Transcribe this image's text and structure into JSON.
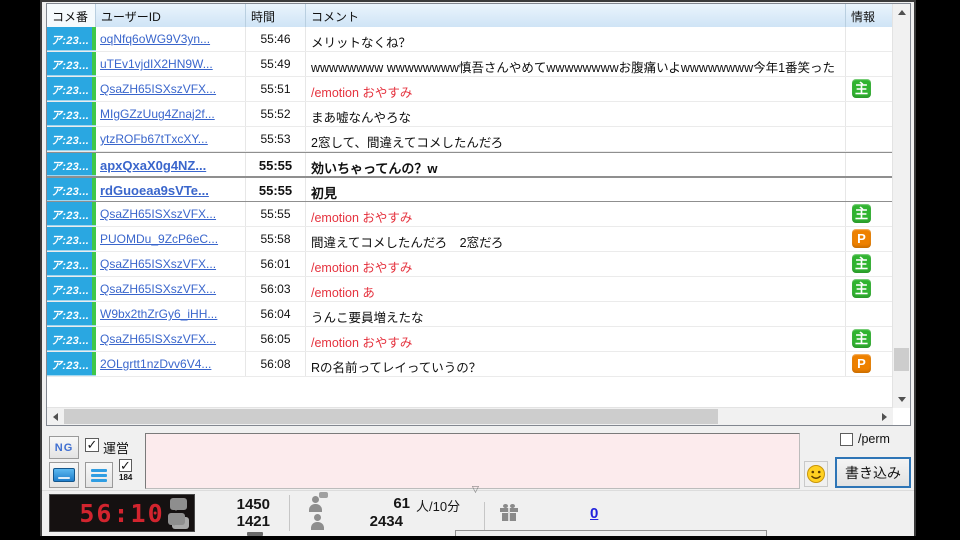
{
  "table": {
    "headers": {
      "num": "コメ番",
      "user": "ユーザーID",
      "time": "時間",
      "comment": "コメント",
      "info": "情報"
    },
    "rows": [
      {
        "seat": "ア:23...",
        "user": "oqNfq6oWG9V3yn...",
        "time": "55:46",
        "comment": "メリットなくね？",
        "red": false,
        "bold": false,
        "badge": ""
      },
      {
        "seat": "ア:23...",
        "user": "uTEv1vjdIX2HN9W...",
        "time": "55:49",
        "comment": "wwwwwwww wwwwwwww慎吾さんやめてwwwwwwwwお腹痛いよwwwwwwww今年1番笑った",
        "red": false,
        "bold": false,
        "badge": ""
      },
      {
        "seat": "ア:23...",
        "user": "QsaZH65ISXszVFX...",
        "time": "55:51",
        "comment": "/emotion おやすみ",
        "red": true,
        "bold": false,
        "badge": "主"
      },
      {
        "seat": "ア:23...",
        "user": "MIgGZzUug4Znaj2f...",
        "time": "55:52",
        "comment": "まあ嘘なんやろな",
        "red": false,
        "bold": false,
        "badge": ""
      },
      {
        "seat": "ア:23...",
        "user": "ytzROFb67tTxcXY...",
        "time": "55:53",
        "comment": "2窓して、間違えてコメしたんだろ",
        "red": false,
        "bold": false,
        "badge": ""
      },
      {
        "seat": "ア:23...",
        "user": "apxQxaX0g4NZ...",
        "time": "55:55",
        "comment": "効いちゃってんの？w",
        "red": false,
        "bold": true,
        "badge": ""
      },
      {
        "seat": "ア:23...",
        "user": "rdGuoeaa9sVTe...",
        "time": "55:55",
        "comment": "初見",
        "red": false,
        "bold": true,
        "badge": ""
      },
      {
        "seat": "ア:23...",
        "user": "QsaZH65ISXszVFX...",
        "time": "55:55",
        "comment": "/emotion おやすみ",
        "red": true,
        "bold": false,
        "badge": "主"
      },
      {
        "seat": "ア:23...",
        "user": "PUOMDu_9ZcP6eC...",
        "time": "55:58",
        "comment": "間違えてコメしたんだろ　2窓だろ",
        "red": false,
        "bold": false,
        "badge": "P"
      },
      {
        "seat": "ア:23...",
        "user": "QsaZH65ISXszVFX...",
        "time": "56:01",
        "comment": "/emotion おやすみ",
        "red": true,
        "bold": false,
        "badge": "主"
      },
      {
        "seat": "ア:23...",
        "user": "QsaZH65ISXszVFX...",
        "time": "56:03",
        "comment": "/emotion あ",
        "red": true,
        "bold": false,
        "badge": "主"
      },
      {
        "seat": "ア:23...",
        "user": "W9bx2thZrGy6_iHH...",
        "time": "56:04",
        "comment": "うんこ要員増えたな",
        "red": false,
        "bold": false,
        "badge": ""
      },
      {
        "seat": "ア:23...",
        "user": "QsaZH65ISXszVFX...",
        "time": "56:05",
        "comment": "/emotion おやすみ",
        "red": true,
        "bold": false,
        "badge": "主"
      },
      {
        "seat": "ア:23...",
        "user": "2OLgrtt1nzDvv6V4...",
        "time": "56:08",
        "comment": "Rの名前ってレイっていうの？",
        "red": false,
        "bold": false,
        "badge": "P"
      }
    ]
  },
  "compose": {
    "ng_label": "NG",
    "moderator_label": "運営",
    "anon_label": "184",
    "perm_label": "/perm",
    "submit_label": "書き込み",
    "message_value": ""
  },
  "status": {
    "elapsed_time": "56:10",
    "comment_count": "1450",
    "comment_count_alt": "1421",
    "visitors_per_10min": "61",
    "visitors_unit": "人/10分",
    "total_visitors": "2434",
    "gift_points": "0",
    "collapse_glyph": "▽"
  },
  "colors": {
    "seat_blue": "#2aa7e1",
    "stripe_green": "#3ec74a",
    "badge_green": "#31b431",
    "badge_orange": "#ee8100",
    "link_blue": "#3a66cc",
    "emotion_red": "#e5333f",
    "timer_red": "#d2242e",
    "input_pink": "#fcebed"
  }
}
